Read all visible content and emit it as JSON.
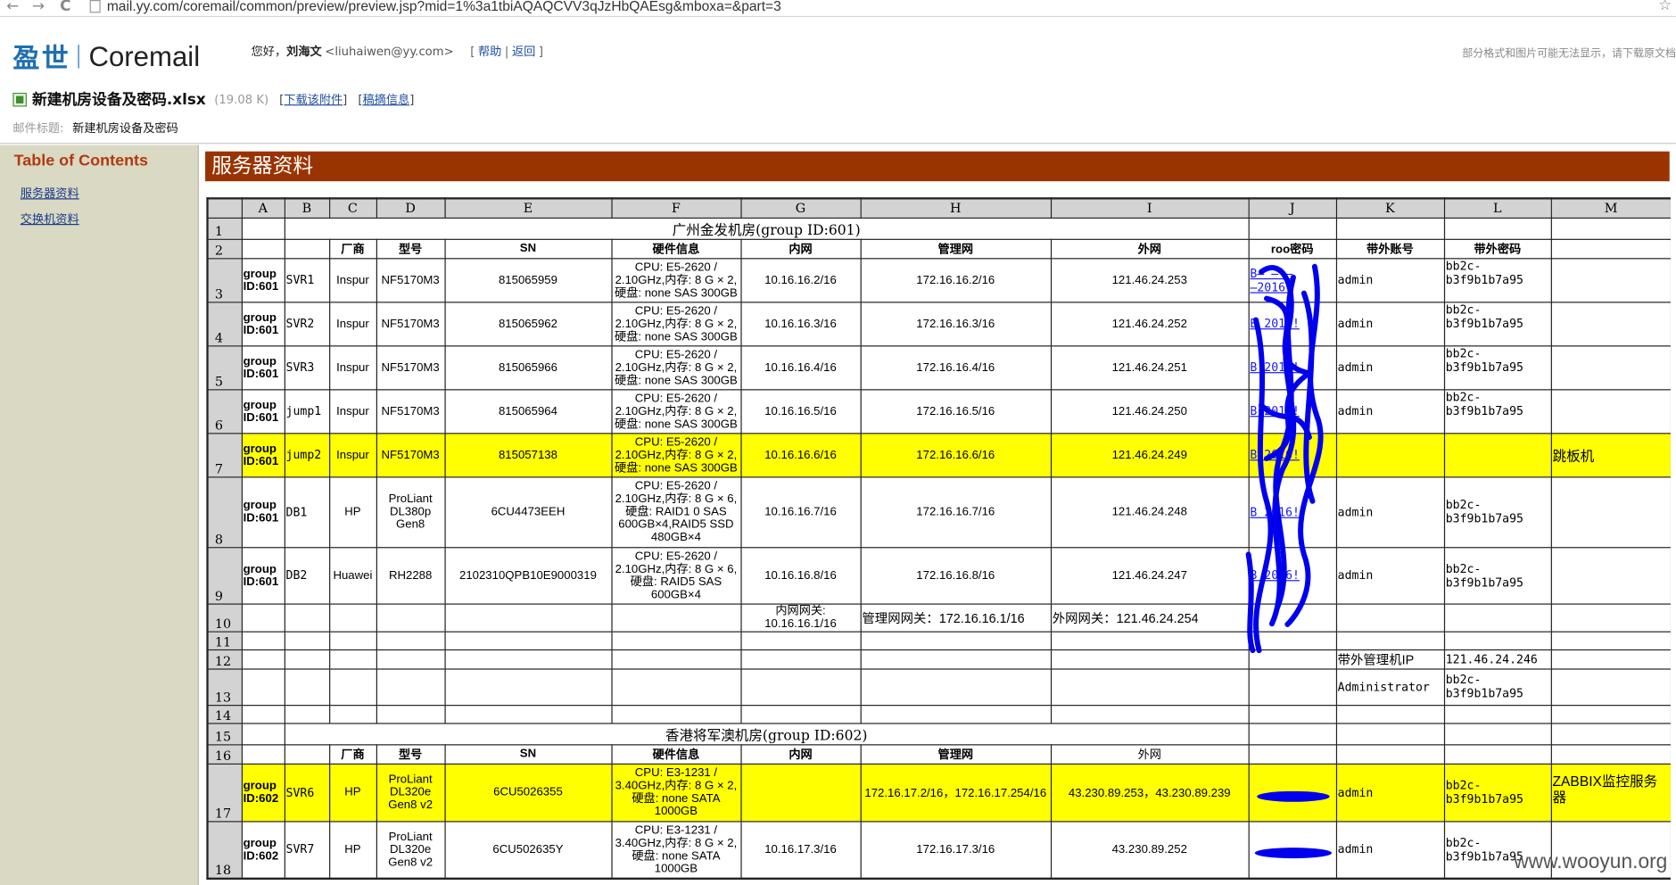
{
  "browser": {
    "url": "mail.yy.com/coremail/common/preview/preview.jsp?mid=1%3a1tbiAQAQCVV3qJzHbQAEsg&mboxa=&part=3",
    "back_glyph": "←",
    "forward_glyph": "→",
    "reload_glyph": "C",
    "bookmark_glyph": "☆"
  },
  "brand": {
    "cn": "盈世",
    "en": "Coremail"
  },
  "greeting": {
    "hello": "您好，",
    "name": "刘海文",
    "email": "<liuhaiwen@yy.com>",
    "bracket_open": "[",
    "help": "帮助",
    "divider": "|",
    "back": "返回",
    "bracket_close": "]"
  },
  "notice": "部分格式和图片可能无法显示，请下载原文档",
  "attachment": {
    "filename": "新建机房设备及密码.xlsx",
    "size": "(19.08 K)",
    "download_label": "下载该附件",
    "info_label": "稿摘信息",
    "bracket_open": "[",
    "bracket_close": "]"
  },
  "subject": {
    "label": "邮件标题:",
    "value": "新建机房设备及密码"
  },
  "toc": {
    "title": "Table of Contents",
    "links": [
      "服务器资料",
      "交换机资料"
    ]
  },
  "sheet_title": "服务器资料",
  "columns": [
    "",
    "A",
    "B",
    "C",
    "D",
    "E",
    "F",
    "G",
    "H",
    "I",
    "J",
    "K",
    "L",
    "M"
  ],
  "header_labels": [
    "厂商",
    "型号",
    "SN",
    "硬件信息",
    "内网",
    "管理网",
    "外网",
    "roo密码",
    "带外账号",
    "带外密码"
  ],
  "rows": {
    "r1": {
      "num": "1",
      "title": "广州金发机房(group ID:601)"
    },
    "r2": {
      "num": "2"
    },
    "r3": {
      "num": "3",
      "group": "group ID:601",
      "name": "SVR1",
      "vendor": "Inspur",
      "model": "NF5170M3",
      "sn": "815065959",
      "hw": "CPU: E5-2620 / 2.10GHz,内存: 8 G × 2, 硬盘: none SAS 300GB",
      "lan": "10.16.16.2/16",
      "mgmt": "172.16.16.2/16",
      "wan": "121.46.24.253",
      "rootpw": "B̶ ̶ ̶ ̶2016!",
      "oob_user": "admin",
      "oob_pw": "bb2c-b3f9b1b7a95"
    },
    "r4": {
      "num": "4",
      "group": "group ID:601",
      "name": "SVR2",
      "vendor": "Inspur",
      "model": "NF5170M3",
      "sn": "815065962",
      "hw": "CPU: E5-2620 / 2.10GHz,内存: 8 G × 2, 硬盘: none SAS 300GB",
      "lan": "10.16.16.3/16",
      "mgmt": "172.16.16.3/16",
      "wan": "121.46.24.252",
      "rootpw": "B   2016!",
      "oob_user": "admin",
      "oob_pw": "bb2c-b3f9b1b7a95"
    },
    "r5": {
      "num": "5",
      "group": "group ID:601",
      "name": "SVR3",
      "vendor": "Inspur",
      "model": "NF5170M3",
      "sn": "815065966",
      "hw": "CPU: E5-2620 / 2.10GHz,内存: 8 G × 2, 硬盘: none SAS 300GB",
      "lan": "10.16.16.4/16",
      "mgmt": "172.16.16.4/16",
      "wan": "121.46.24.251",
      "rootpw": "B   2016!",
      "oob_user": "admin",
      "oob_pw": "bb2c-b3f9b1b7a95"
    },
    "r6": {
      "num": "6",
      "group": "group ID:601",
      "name": "jump1",
      "vendor": "Inspur",
      "model": "NF5170M3",
      "sn": "815065964",
      "hw": "CPU: E5-2620 / 2.10GHz,内存: 8 G × 2, 硬盘: none SAS 300GB",
      "lan": "10.16.16.5/16",
      "mgmt": "172.16.16.5/16",
      "wan": "121.46.24.250",
      "rootpw": "B   2016!",
      "oob_user": "admin",
      "oob_pw": "bb2c-b3f9b1b7a95"
    },
    "r7": {
      "num": "7",
      "group": "group ID:601",
      "name": "jump2",
      "vendor": "Inspur",
      "model": "NF5170M3",
      "sn": "815057138",
      "hw": "CPU: E5-2620 / 2.10GHz,内存: 8 G × 2, 硬盘: none SAS 300GB",
      "lan": "10.16.16.6/16",
      "mgmt": "172.16.16.6/16",
      "wan": "121.46.24.249",
      "rootpw": "B   2016!",
      "note": "跳板机"
    },
    "r8": {
      "num": "8",
      "group": "group ID:601",
      "name": "DB1",
      "vendor": "HP",
      "model": "ProLiant DL380p Gen8",
      "sn": "6CU4473EEH",
      "hw": "CPU: E5-2620 / 2.10GHz,内存: 8 G × 6, 硬盘: RAID1 0 SAS 600GB×4,RAID5 SSD 480GB×4",
      "lan": "10.16.16.7/16",
      "mgmt": "172.16.16.7/16",
      "wan": "121.46.24.248",
      "rootpw": "B   2016!",
      "oob_user": "admin",
      "oob_pw": "bb2c-b3f9b1b7a95"
    },
    "r9": {
      "num": "9",
      "group": "group ID:601",
      "name": "DB2",
      "vendor": "Huawei",
      "model": "RH2288",
      "sn": "2102310QPB10E9000319",
      "hw": "CPU: E5-2620 / 2.10GHz,内存: 8 G × 6, 硬盘: RAID5 SAS 600GB×4",
      "lan": "10.16.16.8/16",
      "mgmt": "172.16.16.8/16",
      "wan": "121.46.24.247",
      "rootpw": "B   2016!",
      "oob_user": "admin",
      "oob_pw": "bb2c-b3f9b1b7a95"
    },
    "r10": {
      "num": "10",
      "lan_gw": "内网网关: 10.16.16.1/16",
      "mgmt_gw": "管理网网关：172.16.16.1/16",
      "wan_gw": "外网网关：121.46.24.254"
    },
    "r11": {
      "num": "11"
    },
    "r12": {
      "num": "12",
      "oob_ip_label": "带外管理机IP",
      "oob_ip": "121.46.24.246"
    },
    "r13": {
      "num": "13",
      "admin_user": "Administrator",
      "admin_pw": "bb2c-b3f9b1b7a95"
    },
    "r14": {
      "num": "14"
    },
    "r15": {
      "num": "15",
      "title": "香港将军澳机房(group ID:602)"
    },
    "r16": {
      "num": "16"
    },
    "r17": {
      "num": "17",
      "group": "group ID:602",
      "name": "SVR6",
      "vendor": "HP",
      "model": "ProLiant DL320e Gen8 v2",
      "sn": "6CU5026355",
      "hw": "CPU: E3-1231 / 3.40GHz,内存: 8 G × 2, 硬盘: none SATA 1000GB",
      "lan": "",
      "mgmt": "172.16.17.2/16，172.16.17.254/16",
      "wan": "43.230.89.253，43.230.89.239",
      "rootpw": "",
      "oob_user": "admin",
      "oob_pw": "bb2c-b3f9b1b7a95",
      "note": "ZABBIX监控服务器"
    },
    "r18": {
      "num": "18",
      "group": "group ID:602",
      "name": "SVR7",
      "vendor": "HP",
      "model": "ProLiant DL320e Gen8 v2",
      "sn": "6CU502635Y",
      "hw": "CPU: E3-1231 / 3.40GHz,内存: 8 G × 2, 硬盘: none SATA 1000GB",
      "lan": "10.16.17.3/16",
      "mgmt": "172.16.17.3/16",
      "wan": "43.230.89.252",
      "rootpw": "",
      "oob_user": "admin",
      "oob_pw": "bb2c-b3f9b1b7a95"
    }
  },
  "watermark": "www.wooyun.org",
  "colors": {
    "banner": "#993300",
    "highlight": "#ffff00",
    "redaction": "#0000ee",
    "toc_bg": "#d9d9c4"
  }
}
